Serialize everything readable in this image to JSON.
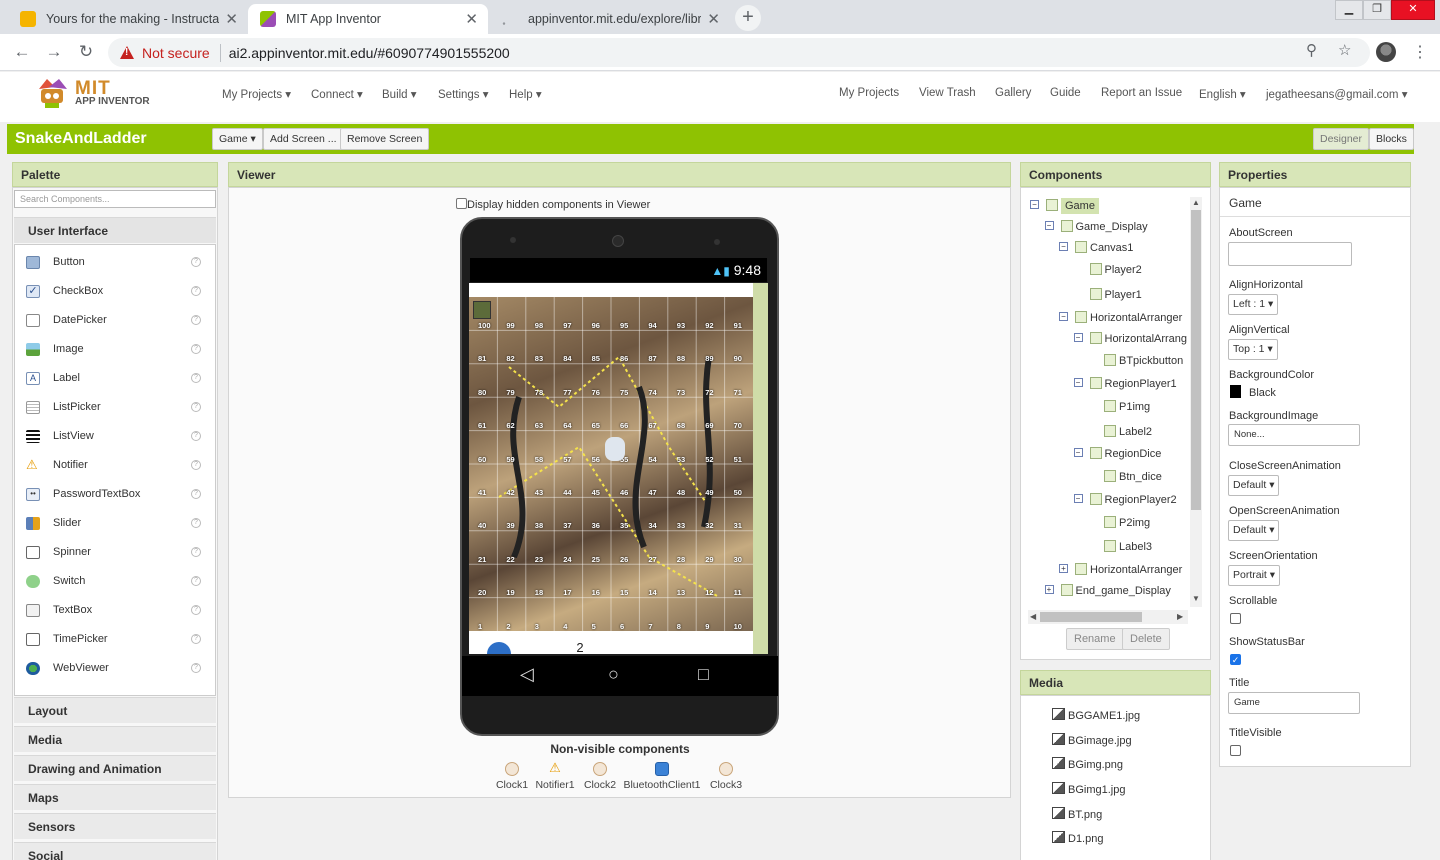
{
  "browser": {
    "tabs": [
      {
        "title": "Yours for the making - Instructab",
        "active": false
      },
      {
        "title": "MIT App Inventor",
        "active": true
      },
      {
        "title": "appinventor.mit.edu/explore/libr",
        "active": false
      }
    ],
    "not_secure": "Not secure",
    "url": "ai2.appinventor.mit.edu/#6090774901555200"
  },
  "app": {
    "logo_text": "MIT",
    "logo_sub": "APP INVENTOR",
    "menu_left": [
      "My Projects",
      "Connect",
      "Build",
      "Settings",
      "Help"
    ],
    "menu_right": [
      "My Projects",
      "View Trash",
      "Gallery",
      "Guide",
      "Report an Issue",
      "English",
      "jegatheesans@gmail.com"
    ],
    "project_name": "SnakeAndLadder",
    "toolbar": {
      "screen_select": "Game",
      "add_screen": "Add Screen ...",
      "remove_screen": "Remove Screen",
      "designer": "Designer",
      "blocks": "Blocks"
    }
  },
  "palette": {
    "title": "Palette",
    "search_placeholder": "Search Components...",
    "open_category": "User Interface",
    "items": [
      {
        "label": "Button",
        "icon": "button-icon"
      },
      {
        "label": "CheckBox",
        "icon": "checkbox-icon"
      },
      {
        "label": "DatePicker",
        "icon": "datepicker-icon"
      },
      {
        "label": "Image",
        "icon": "image-icon"
      },
      {
        "label": "Label",
        "icon": "label-icon"
      },
      {
        "label": "ListPicker",
        "icon": "listpicker-icon"
      },
      {
        "label": "ListView",
        "icon": "listview-icon"
      },
      {
        "label": "Notifier",
        "icon": "notifier-icon"
      },
      {
        "label": "PasswordTextBox",
        "icon": "password-icon"
      },
      {
        "label": "Slider",
        "icon": "slider-icon"
      },
      {
        "label": "Spinner",
        "icon": "spinner-icon"
      },
      {
        "label": "Switch",
        "icon": "switch-icon"
      },
      {
        "label": "TextBox",
        "icon": "textbox-icon"
      },
      {
        "label": "TimePicker",
        "icon": "timepicker-icon"
      },
      {
        "label": "WebViewer",
        "icon": "webviewer-icon"
      }
    ],
    "categories": [
      "Layout",
      "Media",
      "Drawing and Animation",
      "Maps",
      "Sensors",
      "Social"
    ],
    "help_glyph": "?"
  },
  "viewer": {
    "title": "Viewer",
    "hidden_checkbox_label": "Display hidden components in Viewer",
    "status_time": "9:48",
    "board_rows": [
      [
        "100",
        "99",
        "98",
        "97",
        "96",
        "95",
        "94",
        "93",
        "92",
        "91"
      ],
      [
        "81",
        "82",
        "83",
        "84",
        "85",
        "86",
        "87",
        "88",
        "89",
        "90"
      ],
      [
        "80",
        "79",
        "78",
        "77",
        "76",
        "75",
        "74",
        "73",
        "72",
        "71"
      ],
      [
        "61",
        "62",
        "63",
        "64",
        "65",
        "66",
        "67",
        "68",
        "69",
        "70"
      ],
      [
        "60",
        "59",
        "58",
        "57",
        "56",
        "55",
        "54",
        "53",
        "52",
        "51"
      ],
      [
        "41",
        "42",
        "43",
        "44",
        "45",
        "46",
        "47",
        "48",
        "49",
        "50"
      ],
      [
        "40",
        "39",
        "38",
        "37",
        "36",
        "35",
        "34",
        "33",
        "32",
        "31"
      ],
      [
        "21",
        "22",
        "23",
        "24",
        "25",
        "26",
        "27",
        "28",
        "29",
        "30"
      ],
      [
        "20",
        "19",
        "18",
        "17",
        "16",
        "15",
        "14",
        "13",
        "12",
        "11"
      ],
      [
        "1",
        "2",
        "3",
        "4",
        "5",
        "6",
        "7",
        "8",
        "9",
        "10"
      ]
    ],
    "dice_label": "2",
    "nonvisible_title": "Non-visible components",
    "nonvisible": [
      "Clock1",
      "Notifier1",
      "Clock2",
      "BluetoothClient1",
      "Clock3"
    ]
  },
  "components": {
    "title": "Components",
    "tree": [
      {
        "label": "Game",
        "toggle": "⊟",
        "level": 0
      },
      {
        "label": "Game_Display",
        "toggle": "⊟",
        "level": 1
      },
      {
        "label": "Canvas1",
        "toggle": "⊟",
        "level": 2
      },
      {
        "label": "Player2",
        "toggle": "",
        "level": 3
      },
      {
        "label": "Player1",
        "toggle": "",
        "level": 3
      },
      {
        "label": "HorizontalArranger",
        "toggle": "⊟",
        "level": 2
      },
      {
        "label": "HorizontalArrang",
        "toggle": "⊟",
        "level": 3
      },
      {
        "label": "BTpickbutton",
        "toggle": "",
        "level": 4
      },
      {
        "label": "RegionPlayer1",
        "toggle": "⊟",
        "level": 3
      },
      {
        "label": "P1img",
        "toggle": "",
        "level": 4
      },
      {
        "label": "Label2",
        "toggle": "",
        "level": 4
      },
      {
        "label": "RegionDice",
        "toggle": "⊟",
        "level": 3
      },
      {
        "label": "Btn_dice",
        "toggle": "",
        "level": 4
      },
      {
        "label": "RegionPlayer2",
        "toggle": "⊟",
        "level": 3
      },
      {
        "label": "P2img",
        "toggle": "",
        "level": 4
      },
      {
        "label": "Label3",
        "toggle": "",
        "level": 4
      },
      {
        "label": "HorizontalArranger",
        "toggle": "⊞",
        "level": 2
      },
      {
        "label": "End_game_Display",
        "toggle": "⊞",
        "level": 1
      }
    ],
    "rename": "Rename",
    "delete": "Delete"
  },
  "media": {
    "title": "Media",
    "files": [
      "BGGAME1.jpg",
      "BGimage.jpg",
      "BGimg.png",
      "BGimg1.jpg",
      "BT.png",
      "D1.png"
    ]
  },
  "properties": {
    "title": "Properties",
    "component": "Game",
    "AboutScreen": {
      "label": "AboutScreen",
      "value": ""
    },
    "AlignHorizontal": {
      "label": "AlignHorizontal",
      "value": "Left : 1"
    },
    "AlignVertical": {
      "label": "AlignVertical",
      "value": "Top : 1"
    },
    "BackgroundColor": {
      "label": "BackgroundColor",
      "value": "Black",
      "color": "#000000"
    },
    "BackgroundImage": {
      "label": "BackgroundImage",
      "value": "None..."
    },
    "CloseScreenAnimation": {
      "label": "CloseScreenAnimation",
      "value": "Default"
    },
    "OpenScreenAnimation": {
      "label": "OpenScreenAnimation",
      "value": "Default"
    },
    "ScreenOrientation": {
      "label": "ScreenOrientation",
      "value": "Portrait"
    },
    "Scrollable": {
      "label": "Scrollable",
      "checked": false
    },
    "ShowStatusBar": {
      "label": "ShowStatusBar",
      "checked": true
    },
    "Title": {
      "label": "Title",
      "value": "Game"
    },
    "TitleVisible": {
      "label": "TitleVisible",
      "checked": false
    }
  },
  "colors": {
    "brand_green": "#8fc202",
    "panel_header": "#d8e6b8",
    "danger": "#c5221f"
  }
}
